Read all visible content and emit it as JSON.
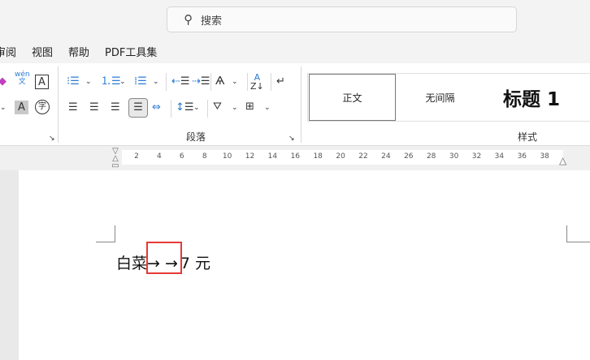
{
  "search": {
    "placeholder": "搜索",
    "icon": "search-icon"
  },
  "menu": [
    "审阅",
    "视图",
    "帮助",
    "PDF工具集"
  ],
  "ribbon": {
    "font_partial": {
      "phonetic_label": "wén\n文",
      "box_letter": "A",
      "shade_letter": "A",
      "enclose_char": "字"
    },
    "paragraph_group_label": "段落",
    "styles_group_label": "样式",
    "styles": [
      "正文",
      "无间隔",
      "标题 1"
    ]
  },
  "ruler": {
    "ticks": [
      "2",
      "4",
      "6",
      "8",
      "10",
      "12",
      "14",
      "16",
      "18",
      "20",
      "22",
      "24",
      "26",
      "28",
      "30",
      "32",
      "34",
      "36",
      "38"
    ]
  },
  "document": {
    "text_before": "白菜",
    "tabs": "→ →",
    "text_after": "7 元"
  },
  "colors": {
    "accent": "#2b7cd3",
    "highlight_box": "#e53935"
  }
}
